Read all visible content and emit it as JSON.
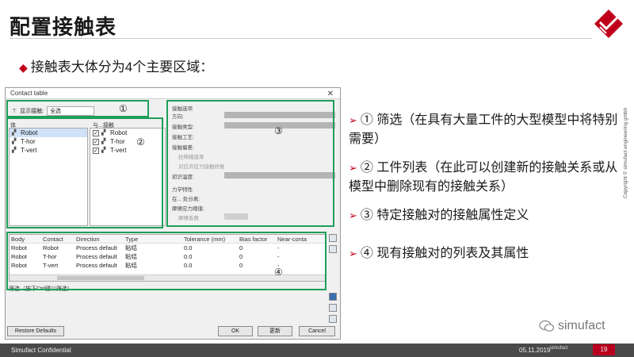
{
  "slide": {
    "title": "配置接触表",
    "subtitle": "接触表大体分为4个主要区域：",
    "footer_left": "Simufact Confidential",
    "footer_date": "05.11.2019",
    "footer_brand": "simufact",
    "page_number": "19",
    "copyright": "Copyright © simufact engineering gmbh",
    "wechat_brand": "simufact",
    "accent_color": "#c0001a",
    "frame_color": "#1f9e5a"
  },
  "dialog": {
    "title": "Contact table",
    "close_icon": "close-icon",
    "filter": {
      "label": "显示接触:",
      "value": "全选"
    },
    "bodies_label": "体",
    "contact_with_label": "与...接触",
    "bodies": [
      "Robot",
      "T-hor",
      "T-vert"
    ],
    "contacts": [
      "Robot",
      "T-hor",
      "T-vert"
    ],
    "props": {
      "section": "接触选项",
      "direction": "方向:",
      "contact_type": "接触类型:",
      "contact_process": "接触工艺:",
      "contact_tolerance": "接触偏差:",
      "opt1": "拉伸阈值率",
      "opt2": "对应点应力接触修复",
      "temperature": "初识温度:",
      "mech": "力学特性",
      "mech_sub": "在... 处分离:",
      "friction": "摩擦应力阈值:",
      "dim_row": "摩擦系数"
    },
    "table": {
      "headers": [
        "Body",
        "Contact",
        "Direction",
        "Type",
        "Tolerance (mm)",
        "Bias factor",
        "Near-conta"
      ],
      "rows": [
        [
          "Robot",
          "Robot",
          "Process default",
          "粘结",
          "0.0",
          "0",
          "-"
        ],
        [
          "Robot",
          "T-hor",
          "Process default",
          "粘结",
          "0.0",
          "0",
          "-"
        ],
        [
          "Robot",
          "T-vert",
          "Process default",
          "粘结",
          "0.0",
          "0",
          "-"
        ]
      ]
    },
    "status": "筛选（按下Ctrl键以筛选）",
    "buttons": {
      "restore": "Restore Defaults",
      "ok": "OK",
      "apply": "更新",
      "cancel": "Cancel"
    }
  },
  "callouts": [
    "①",
    "②",
    "③",
    "④"
  ],
  "bullets": [
    "① 筛选（在具有大量工件的大型模型中将特别需要）",
    "② 工件列表（在此可以创建新的接触关系或从模型中删除现有的接触关系）",
    "③ 特定接触对的接触属性定义",
    "④ 现有接触对的列表及其属性"
  ]
}
